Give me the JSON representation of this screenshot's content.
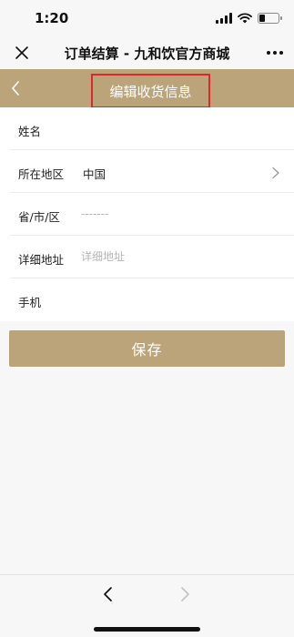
{
  "status_bar": {
    "time": "1:20"
  },
  "wechat_nav": {
    "title": "订单结算 - 九和饮官方商城"
  },
  "page_header": {
    "title": "编辑收货信息"
  },
  "form": {
    "name_label": "姓名",
    "region_label": "所在地区",
    "region_value": "中国",
    "city_label": "省/市/区",
    "city_placeholder": "-------",
    "address_label": "详细地址",
    "address_placeholder": "详细地址",
    "phone_label": "手机"
  },
  "save_label": "保存",
  "colors": {
    "brand": "#bba47a",
    "highlight_border": "#e0262c"
  }
}
